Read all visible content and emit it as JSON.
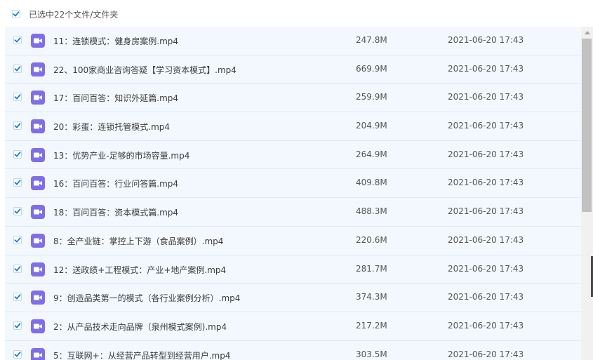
{
  "header": {
    "selection_label": "已选中22个文件/文件夹",
    "select_all_checked": true
  },
  "colors": {
    "checkbox_accent": "#0a7ddb",
    "video_icon": "#7e6fe8",
    "row_selected_bg": "#f2f8fe",
    "row_divider": "#dde9f5",
    "scroll_thumb": "#c1c1c1"
  },
  "files": [
    {
      "name": "11：连锁模式：健身房案例.mp4",
      "size": "247.8M",
      "date": "2021-06-20 17:43",
      "checked": true,
      "icon": "video-file-icon"
    },
    {
      "name": "22、100家商业咨询答疑【学习资本模式】.mp4",
      "size": "669.9M",
      "date": "2021-06-20 17:43",
      "checked": true,
      "icon": "video-file-icon"
    },
    {
      "name": "17：百问百答：知识外延篇.mp4",
      "size": "259.9M",
      "date": "2021-06-20 17:43",
      "checked": true,
      "icon": "video-file-icon"
    },
    {
      "name": "20：彩蛋：连锁托管模式.mp4",
      "size": "204.9M",
      "date": "2021-06-20 17:43",
      "checked": true,
      "icon": "video-file-icon"
    },
    {
      "name": "13：优势产业-足够的市场容量.mp4",
      "size": "264.9M",
      "date": "2021-06-20 17:43",
      "checked": true,
      "icon": "video-file-icon"
    },
    {
      "name": "16：百问百答：行业问答篇.mp4",
      "size": "409.8M",
      "date": "2021-06-20 17:43",
      "checked": true,
      "icon": "video-file-icon"
    },
    {
      "name": "18：百问百答：资本模式篇.mp4",
      "size": "488.3M",
      "date": "2021-06-20 17:43",
      "checked": true,
      "icon": "video-file-icon"
    },
    {
      "name": "8：全产业链：掌控上下游（食品案例）.mp4",
      "size": "220.6M",
      "date": "2021-06-20 17:43",
      "checked": true,
      "icon": "video-file-icon"
    },
    {
      "name": "12：送政绩+工程模式：产业+地产案例.mp4",
      "size": "281.7M",
      "date": "2021-06-20 17:43",
      "checked": true,
      "icon": "video-file-icon"
    },
    {
      "name": "9：创造品类第一的模式（各行业案例分析）.mp4",
      "size": "374.3M",
      "date": "2021-06-20 17:43",
      "checked": true,
      "icon": "video-file-icon"
    },
    {
      "name": "2：从产品技术走向品牌（泉州模式案例).mp4",
      "size": "217.2M",
      "date": "2021-06-20 17:43",
      "checked": true,
      "icon": "video-file-icon"
    },
    {
      "name": "5：互联网+：从经营产品转型到经营用户.mp4",
      "size": "303.5M",
      "date": "2021-06-20 17:43",
      "checked": true,
      "icon": "video-file-icon"
    }
  ]
}
